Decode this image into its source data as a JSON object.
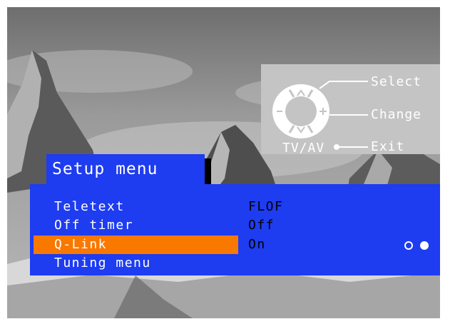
{
  "hint_panel": {
    "select_label": "Select",
    "change_label": "Change",
    "exit_label": "Exit",
    "tvav_label": "TV/AV"
  },
  "menu": {
    "title": "Setup menu",
    "items": [
      {
        "label": "Teletext",
        "value": "FLOF",
        "selected": false
      },
      {
        "label": "Off timer",
        "value": "Off",
        "selected": false
      },
      {
        "label": "Q-Link",
        "value": "On",
        "selected": true
      },
      {
        "label": "Tuning menu",
        "value": "",
        "selected": false
      }
    ],
    "page_indicator": {
      "pages": 2,
      "current": 2
    }
  },
  "colors": {
    "menu_blue": "#1e3cf0",
    "highlight_orange": "#f87800",
    "hint_gray": "#c4c4c4"
  }
}
